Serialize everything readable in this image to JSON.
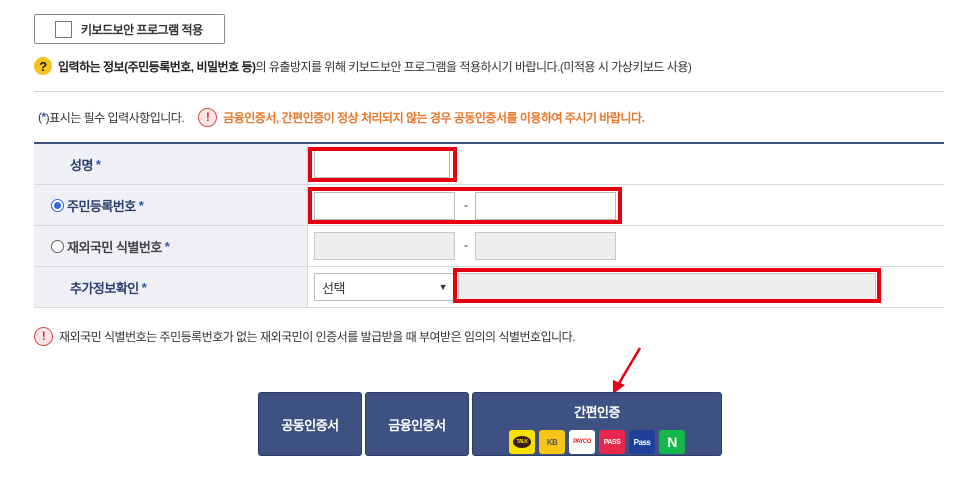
{
  "keyboard_security": {
    "label": "키보드보안 프로그램 적용",
    "checked": false
  },
  "info": {
    "icon": "question-icon",
    "bold_text": "입력하는 정보(주민등록번호, 비밀번호 등)",
    "rest_text": "의 유출방지를 위해 키보드보안 프로그램을 적용하시기 바랍니다.(미적용 시 가상키보드 사용)"
  },
  "required_note": {
    "prefix": "(",
    "star": "*",
    "suffix": ")표시는 필수 입력사항입니다.",
    "warning_icon": "exclamation-icon",
    "warning_text": "금융인증서, 간편인증이 정상 처리되지 않는 경우 공동인증서를 이용하여 주시기 바랍니다."
  },
  "form": {
    "name_label": "성명",
    "rrn_label": "주민등록번호",
    "foreigner_label": "재외국민 식별번호",
    "extra_label": "추가정보확인",
    "star": "*",
    "dash": "-",
    "select_value": "선택",
    "selected_radio": "rrn"
  },
  "footnote": {
    "icon": "exclamation-icon",
    "text": "재외국민 식별번호는 주민등록번호가 없는 재외국민이 인증서를 발급받을 때 부여받은 임의의 식별번호입니다."
  },
  "buttons": {
    "joint_cert": "공동인증서",
    "financial_cert": "금융인증서",
    "easy_auth": "간편인증",
    "easy_auth_logos": [
      "TALK",
      "KB",
      "PAYCO",
      "PASS",
      "Pass",
      "N"
    ]
  },
  "colors": {
    "header_bg": "#eef0f6",
    "label_text": "#2e3f6e",
    "button_bg": "#3d5283",
    "highlight": "#e60012",
    "warning_text": "#e8762a"
  }
}
